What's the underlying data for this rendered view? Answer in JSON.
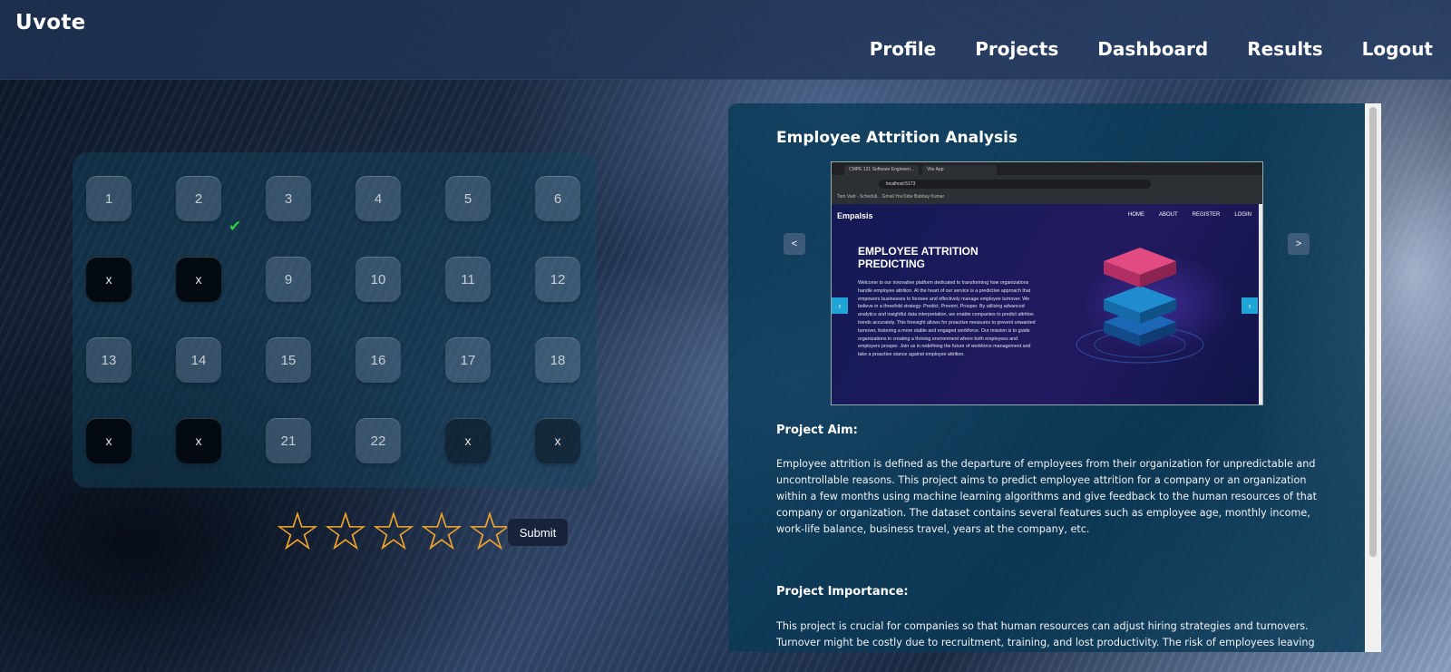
{
  "app": {
    "title": "Uvote"
  },
  "nav": {
    "items": [
      "Profile",
      "Projects",
      "Dashboard",
      "Results",
      "Logout"
    ]
  },
  "grid": {
    "cells": [
      {
        "label": "1",
        "state": "open"
      },
      {
        "label": "2",
        "state": "open"
      },
      {
        "label": "3",
        "state": "open"
      },
      {
        "label": "4",
        "state": "open"
      },
      {
        "label": "5",
        "state": "open"
      },
      {
        "label": "6",
        "state": "open"
      },
      {
        "label": "x",
        "state": "closed"
      },
      {
        "label": "x",
        "state": "closed"
      },
      {
        "label": "9",
        "state": "open"
      },
      {
        "label": "10",
        "state": "open"
      },
      {
        "label": "11",
        "state": "open"
      },
      {
        "label": "12",
        "state": "open"
      },
      {
        "label": "13",
        "state": "open"
      },
      {
        "label": "14",
        "state": "open"
      },
      {
        "label": "15",
        "state": "open"
      },
      {
        "label": "16",
        "state": "open"
      },
      {
        "label": "17",
        "state": "open"
      },
      {
        "label": "18",
        "state": "open"
      },
      {
        "label": "x",
        "state": "closed"
      },
      {
        "label": "x",
        "state": "closed"
      },
      {
        "label": "21",
        "state": "open"
      },
      {
        "label": "22",
        "state": "open"
      },
      {
        "label": "x",
        "state": "closed-faded"
      },
      {
        "label": "x",
        "state": "closed-faded"
      }
    ],
    "voted_mark": "✔"
  },
  "rating": {
    "star_glyph": "☆",
    "max": 5,
    "value": 0,
    "color": "#f4a62a",
    "submit_label": "Submit"
  },
  "project": {
    "title": "Employee Attrition Analysis",
    "carousel": {
      "prev_label": "<",
      "next_label": ">"
    },
    "preview": {
      "tabs": [
        "CMPE 131 Software Engineeri...",
        "Vite App"
      ],
      "url": "localhost:5173",
      "bookmarks": "Tam Vadi - Scheduli...   Gmail   YouTube   Bubbay Kumar",
      "site_brand": "Empalsis",
      "site_nav": [
        "HOME",
        "ABOUT",
        "REGISTER",
        "LOGIN"
      ],
      "site_heading": "EMPLOYEE ATTRITION PREDICTING",
      "site_text": "Welcome to our innovative platform dedicated to transforming how organizations handle employee attrition. At the heart of our service is a predictive approach that empowers businesses to foresee and effectively manage employee turnover. We believe in a threefold strategy: Predict, Prevent, Prosper. By utilizing advanced analytics and insightful data interpretation, we enable companies to predict attrition trends accurately. This foresight allows for proactive measures to prevent unwanted turnover, fostering a more stable and engaged workforce. Our mission is to guide organizations in creating a thriving environment where both employees and employers prosper. Join us in redefining the future of workforce management and take a proactive stance against employee attrition.",
      "site_prev": "‹",
      "site_next": "›"
    },
    "aim_heading": "Project Aim:",
    "aim_text": "Employee attrition is defined as the departure of employees from their organization for unpredictable and uncontrollable reasons. This project aims to predict employee attrition for a company or an organization within a few months using machine learning algorithms and give feedback to the human resources of that company or organization. The dataset contains several features such as employee age, monthly income, work-life balance, business travel, years at the company, etc.",
    "importance_heading": "Project Importance:",
    "importance_text": "This project is crucial for companies so that human resources can adjust hiring strategies and turnovers. Turnover might be costly due to recruitment, training, and lost productivity. The risk of employees leaving can"
  }
}
